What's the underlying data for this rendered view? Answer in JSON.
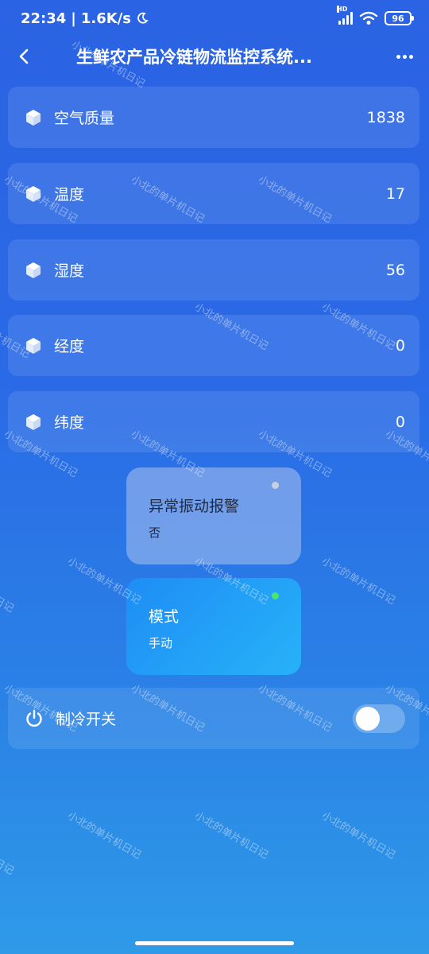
{
  "status": {
    "time": "22:34",
    "speed": "1.6K/s",
    "hd": "HD",
    "battery": "96"
  },
  "header": {
    "title": "生鲜农产品冷链物流监控系统..."
  },
  "sensors": [
    {
      "label": "空气质量",
      "value": "1838"
    },
    {
      "label": "温度",
      "value": "17"
    },
    {
      "label": "湿度",
      "value": "56"
    },
    {
      "label": "经度",
      "value": "0"
    },
    {
      "label": "纬度",
      "value": "0"
    }
  ],
  "alarm": {
    "title": "异常振动报警",
    "value": "否"
  },
  "mode": {
    "title": "模式",
    "value": "手动"
  },
  "cooling": {
    "label": "制冷开关",
    "on": false
  },
  "watermark_text": "小北的单片机日记",
  "colors": {
    "background_top": "#2a63e3",
    "background_bottom": "#2f9ae8",
    "active_tile": "#1e8df5",
    "status_green": "#4be371"
  }
}
